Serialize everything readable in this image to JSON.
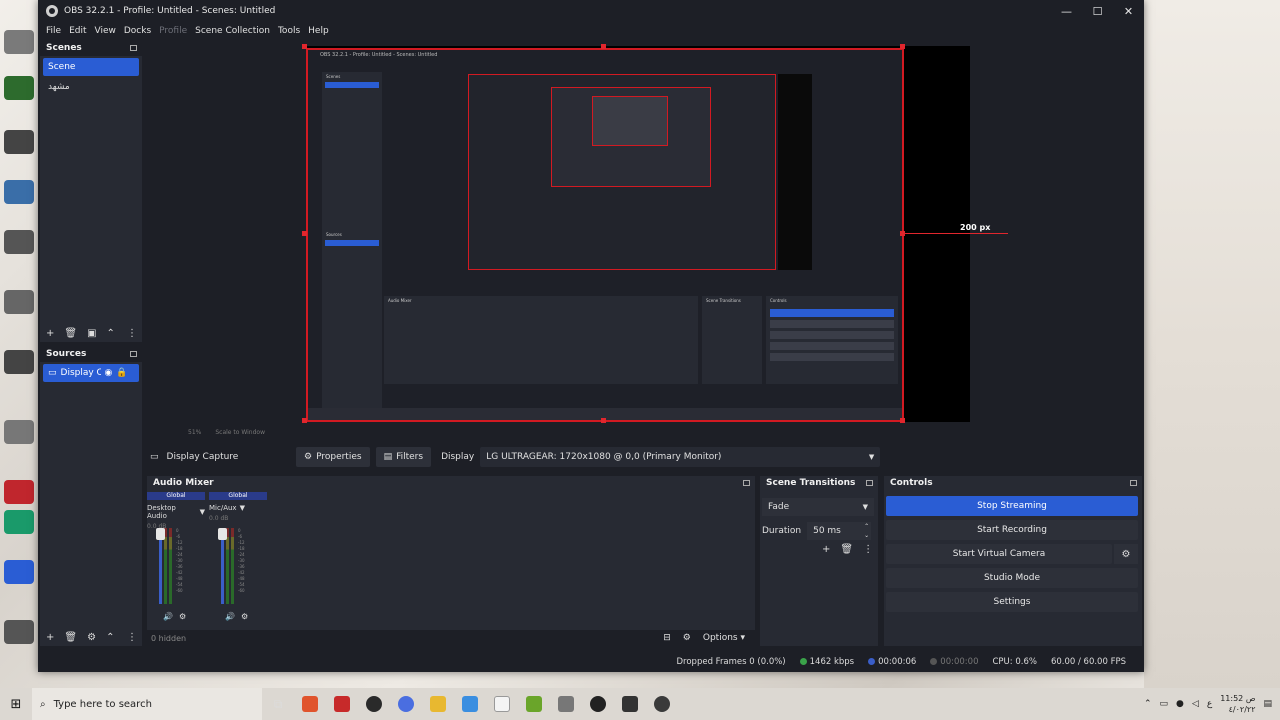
{
  "window": {
    "title": "OBS 32.2.1 - Profile: Untitled - Scenes: Untitled",
    "minimize": "—",
    "maximize": "☐",
    "close": "✕"
  },
  "menu": [
    "File",
    "Edit",
    "View",
    "Docks",
    "Profile",
    "Scene Collection",
    "Tools",
    "Help"
  ],
  "scenes": {
    "title": "Scenes",
    "items": [
      "Scene",
      "مشهد"
    ]
  },
  "sources": {
    "title": "Sources",
    "items": [
      "Display Ca"
    ]
  },
  "preview": {
    "px_label": "200 px",
    "nested_title": "OBS 32.2.1 - Profile: Untitled - Scenes: Untitled",
    "nested_scenes": "Scenes",
    "nested_sources": "Sources",
    "nested_audio": "Audio Mixer",
    "nested_transitions": "Scene Transitions",
    "nested_controls": "Controls"
  },
  "zoom": {
    "value": "51%",
    "mode": "Scale to Window"
  },
  "source_toolbar": {
    "source_name": "Display Capture",
    "properties": "Properties",
    "filters": "Filters",
    "display_label": "Display",
    "display_value": "LG ULTRAGEAR: 1720x1080 @ 0,0 (Primary Monitor)"
  },
  "audio_mixer": {
    "title": "Audio Mixer",
    "channels": [
      {
        "global": "Global",
        "name": "Desktop Audio",
        "db": "0.0 dB"
      },
      {
        "global": "Global",
        "name": "Mic/Aux",
        "db": "0.0 dB"
      }
    ],
    "scale": [
      "0",
      "-6",
      "-12",
      "-18",
      "-24",
      "-30",
      "-36",
      "-42",
      "-48",
      "-54",
      "-60"
    ],
    "hidden": "0 hidden",
    "options": "Options"
  },
  "transitions": {
    "title": "Scene Transitions",
    "type": "Fade",
    "duration_label": "Duration",
    "duration_value": "50 ms"
  },
  "controls": {
    "title": "Controls",
    "stop_streaming": "Stop Streaming",
    "start_recording": "Start Recording",
    "start_virtual_camera": "Start Virtual Camera",
    "studio_mode": "Studio Mode",
    "settings": "Settings"
  },
  "status": {
    "dropped_frames": "Dropped Frames 0 (0.0%)",
    "bitrate": "1462 kbps",
    "stream_time": "00:00:06",
    "record_time": "00:00:00",
    "cpu": "CPU: 0.6%",
    "fps": "60.00 / 60.00 FPS"
  },
  "taskbar": {
    "search_placeholder": "Type here to search",
    "time": "11:52 ص",
    "date": "٤/٠٢/٢٢",
    "lang": "ع"
  },
  "colors": {
    "accent": "#2a5dd4",
    "selection_red": "#e1262d",
    "panel": "#272a33",
    "window_bg": "#1d1f26"
  }
}
